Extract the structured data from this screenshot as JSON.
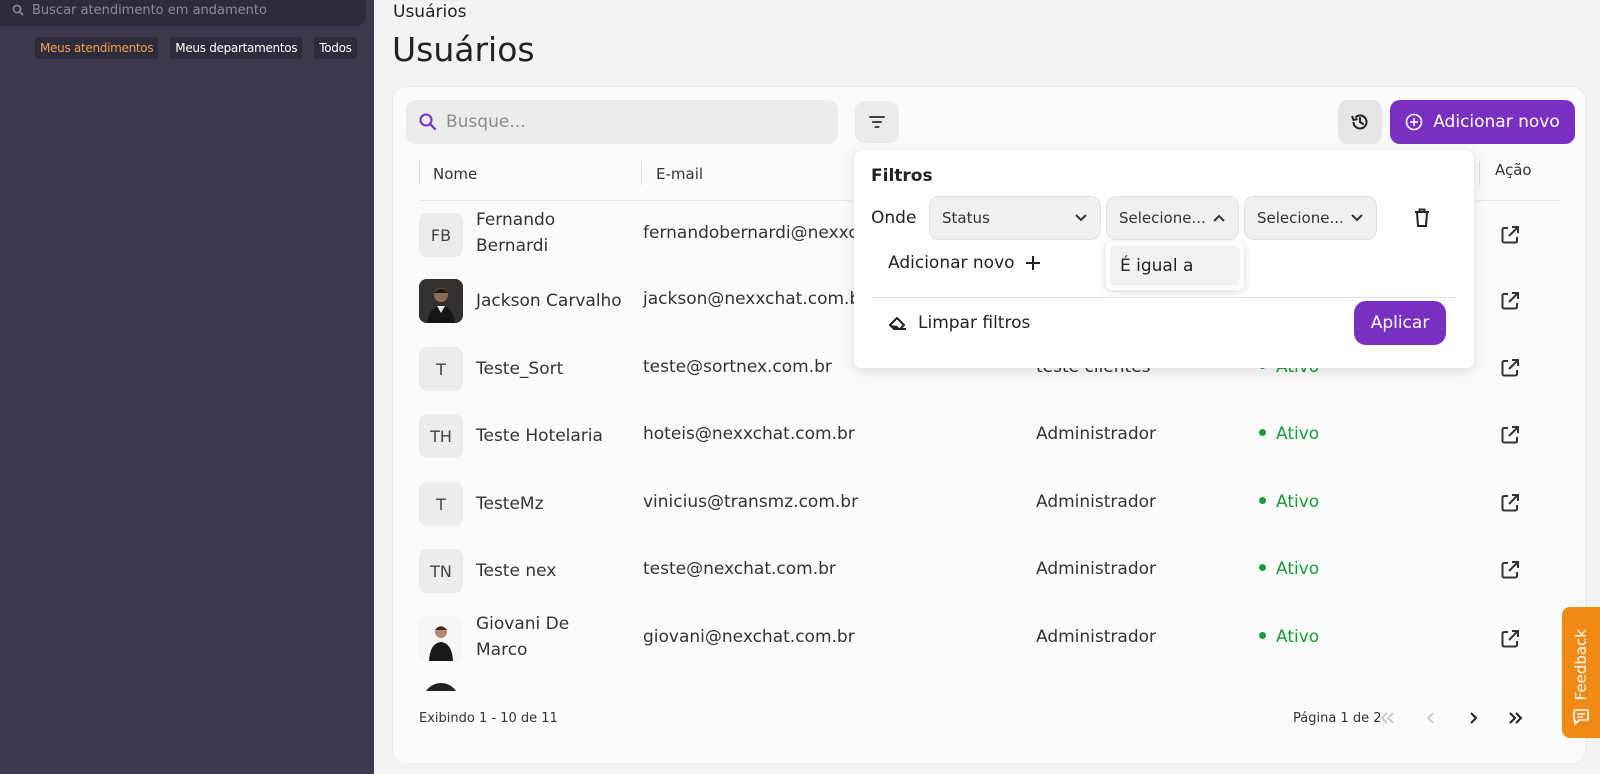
{
  "sidebar": {
    "search_placeholder": "Buscar atendimento em andamento",
    "tabs": [
      {
        "label": "Meus atendimentos",
        "active": true
      },
      {
        "label": "Meus departamentos",
        "active": false
      },
      {
        "label": "Todos",
        "active": false
      }
    ]
  },
  "header": {
    "breadcrumb": "Usuários",
    "title": "Usuários"
  },
  "toolbar": {
    "search_placeholder": "Busque...",
    "add_label": "Adicionar novo"
  },
  "table": {
    "columns": {
      "name": "Nome",
      "email": "E-mail",
      "action": "Ação"
    },
    "rows": [
      {
        "initials": "FB",
        "name": "Fernando Bernardi",
        "email": "fernandobernardi@nexxc",
        "role": "",
        "status": ""
      },
      {
        "initials": "",
        "name": "Jackson Carvalho",
        "email": "jackson@nexxchat.com.b",
        "role": "",
        "status": ""
      },
      {
        "initials": "T",
        "name": "Teste_Sort",
        "email": "teste@sortnex.com.br",
        "role": "teste clientes",
        "status": "Ativo"
      },
      {
        "initials": "TH",
        "name": "Teste Hotelaria",
        "email": "hoteis@nexxchat.com.br",
        "role": "Administrador",
        "status": "Ativo"
      },
      {
        "initials": "T",
        "name": "TesteMz",
        "email": "vinicius@transmz.com.br",
        "role": "Administrador",
        "status": "Ativo"
      },
      {
        "initials": "TN",
        "name": "Teste nex",
        "email": "teste@nexchat.com.br",
        "role": "Administrador",
        "status": "Ativo"
      },
      {
        "initials": "",
        "name": "Giovani De Marco",
        "email": "giovani@nexchat.com.br",
        "role": "Administrador",
        "status": "Ativo"
      }
    ]
  },
  "footer": {
    "showing": "Exibindo 1 - 10 de 11",
    "page": "Página 1 de 2"
  },
  "filter_popover": {
    "title": "Filtros",
    "where_label": "Onde",
    "field_select": "Status",
    "operator_select": "Selecione...",
    "value_select": "Selecione...",
    "operator_option": "É igual a",
    "add_label": "Adicionar novo",
    "clear_label": "Limpar filtros",
    "apply_label": "Aplicar"
  },
  "feedback": {
    "label": "Feedback"
  },
  "colors": {
    "accent": "#7a2fc3",
    "sidebar": "#3a3a4c",
    "status_active": "#1a9a3a",
    "feedback": "#f08a12",
    "active_tab": "#f5a04a"
  }
}
